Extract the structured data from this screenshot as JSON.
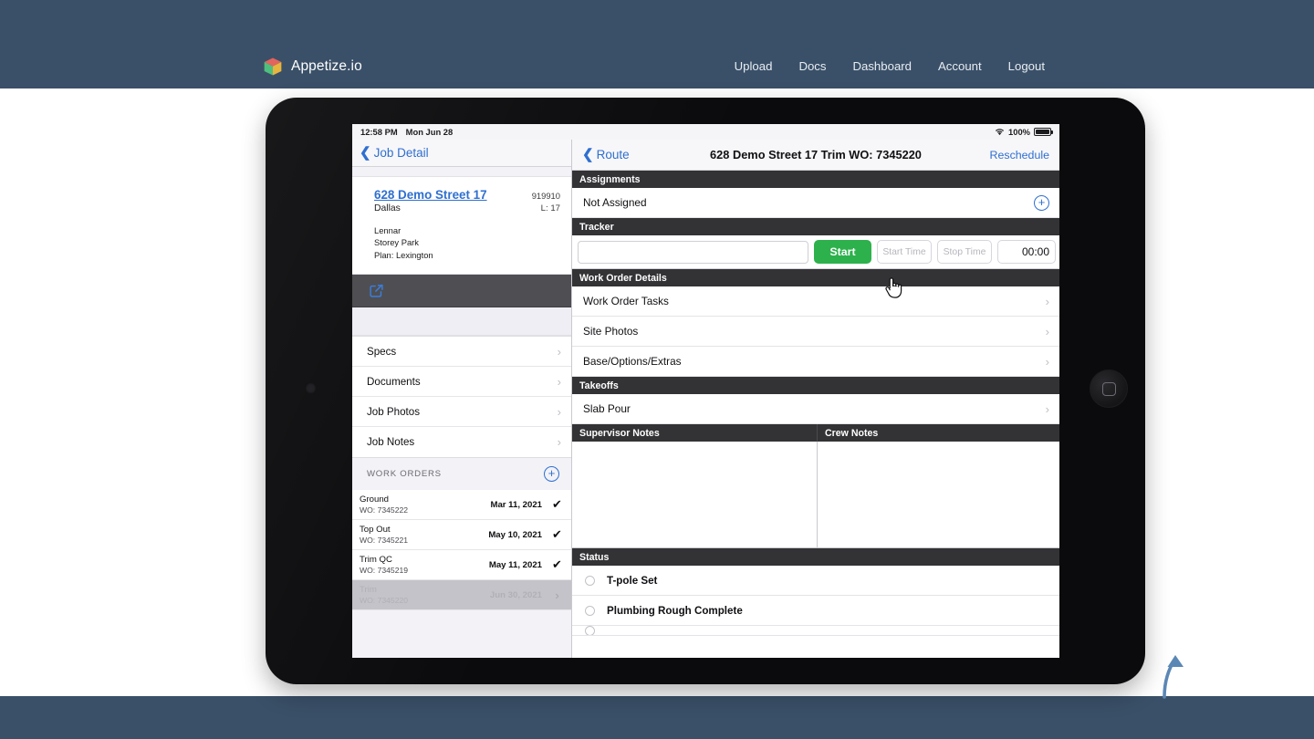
{
  "site": {
    "brand_name": "Appetize.io",
    "logo_icon": "cube-logo-icon",
    "nav": [
      {
        "label": "Upload",
        "name": "nav-upload"
      },
      {
        "label": "Docs",
        "name": "nav-docs"
      },
      {
        "label": "Dashboard",
        "name": "nav-dashboard"
      },
      {
        "label": "Account",
        "name": "nav-account"
      },
      {
        "label": "Logout",
        "name": "nav-logout"
      }
    ],
    "band_color": "#3a5068"
  },
  "device": {
    "frame": "tablet-landscape",
    "home_button_icon": "home-square-icon",
    "camera_icon": "front-camera-icon"
  },
  "statusbar": {
    "time": "12:58 PM",
    "date": "Mon Jun 28",
    "wifi_icon": "wifi-icon",
    "battery_percent": "100%",
    "battery_icon": "battery-full-icon"
  },
  "left_pane": {
    "back_label": "Job Detail",
    "back_icon": "chevron-left-icon",
    "job_card": {
      "address": "628 Demo Street 17",
      "job_id": "919910",
      "city": "Dallas",
      "lot": "L: 17",
      "builder": "Lennar",
      "community": "Storey Park",
      "plan": "Plan: Lexington"
    },
    "edit_icon": "edit-square-icon",
    "menu": [
      {
        "label": "Specs",
        "name": "sidebar-item-specs"
      },
      {
        "label": "Documents",
        "name": "sidebar-item-documents"
      },
      {
        "label": "Job Photos",
        "name": "sidebar-item-job-photos"
      },
      {
        "label": "Job Notes",
        "name": "sidebar-item-job-notes"
      }
    ],
    "work_orders_header": "WORK ORDERS",
    "add_work_order_icon": "plus-circle-icon",
    "work_orders": [
      {
        "name": "Ground",
        "wo": "WO: 7345222",
        "date": "Mar 11, 2021",
        "done": true,
        "selected": false
      },
      {
        "name": "Top Out",
        "wo": "WO: 7345221",
        "date": "May 10, 2021",
        "done": true,
        "selected": false
      },
      {
        "name": "Trim QC",
        "wo": "WO: 7345219",
        "date": "May 11, 2021",
        "done": true,
        "selected": false
      },
      {
        "name": "Trim",
        "wo": "WO: 7345220",
        "date": "Jun 30, 2021",
        "done": false,
        "selected": true
      }
    ],
    "check_glyph": "✔",
    "chevron_glyph": "›"
  },
  "right_pane": {
    "back_label": "Route",
    "back_icon": "chevron-left-icon",
    "title": "628 Demo Street 17  Trim WO: 7345220",
    "reschedule_label": "Reschedule",
    "assignments": {
      "header": "Assignments",
      "value": "Not Assigned",
      "add_icon": "plus-circle-icon"
    },
    "tracker": {
      "header": "Tracker",
      "note_value": "",
      "note_placeholder": "",
      "start_label": "Start",
      "start_time_placeholder": "Start Time",
      "stop_time_placeholder": "Stop Time",
      "elapsed": "00:00",
      "start_color": "#2db14c"
    },
    "work_order_details": {
      "header": "Work Order Details",
      "items": [
        {
          "label": "Work Order Tasks",
          "name": "row-work-order-tasks"
        },
        {
          "label": "Site Photos",
          "name": "row-site-photos"
        },
        {
          "label": "Base/Options/Extras",
          "name": "row-base-options-extras"
        }
      ]
    },
    "takeoffs": {
      "header": "Takeoffs",
      "items": [
        {
          "label": "Slab Pour",
          "name": "row-slab-pour"
        }
      ]
    },
    "notes": {
      "supervisor_header": "Supervisor Notes",
      "crew_header": "Crew Notes",
      "supervisor_value": "",
      "crew_value": ""
    },
    "status": {
      "header": "Status",
      "items": [
        {
          "label": "T-pole Set",
          "checked": false,
          "clipped": false
        },
        {
          "label": "Plumbing Rough Complete",
          "checked": false,
          "clipped": false
        },
        {
          "label": "",
          "checked": false,
          "clipped": true
        }
      ]
    },
    "chevron_glyph": "›"
  },
  "overlay": {
    "cursor_icon": "pointing-hand-cursor",
    "arrow_icon": "curved-up-arrow-icon"
  }
}
